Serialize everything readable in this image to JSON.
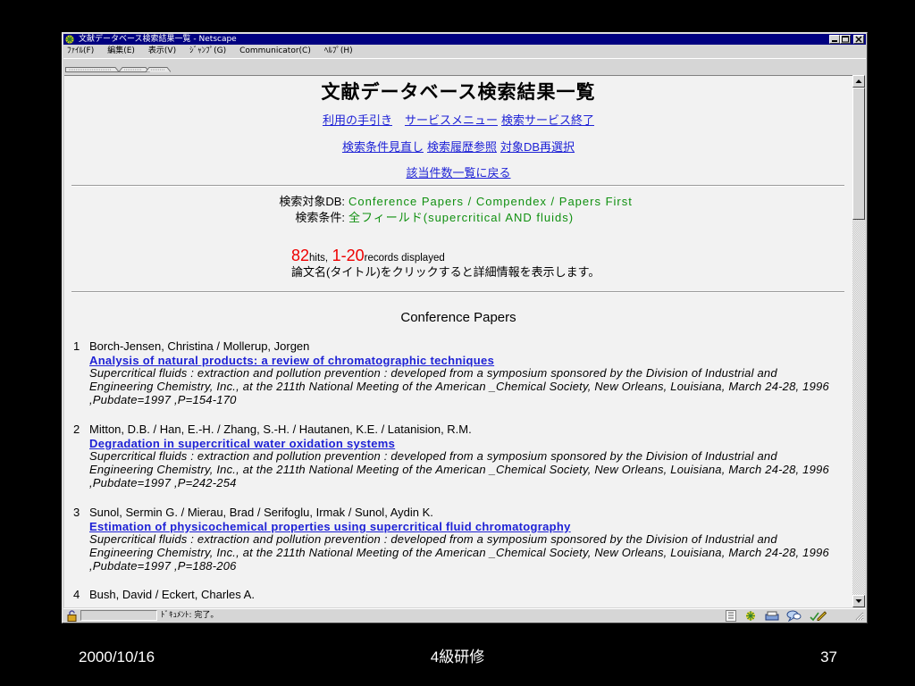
{
  "window": {
    "title": "文献データベース検索結果一覧 - Netscape",
    "menu": [
      "ﾌｧｲﾙ(F)",
      "編集(E)",
      "表示(V)",
      "ｼﾞｬﾝﾌﾟ(G)",
      "Communicator(C)",
      "ﾍﾙﾌﾟ(H)"
    ],
    "status_text": "ﾄﾞｷｭﾒﾝﾄ: 完了。",
    "icons": {
      "title": "netscape-icon",
      "window_buttons": [
        "minimize-icon",
        "maximize-icon",
        "close-icon"
      ],
      "scroll": [
        "arrow-up-icon",
        "arrow-down-icon"
      ],
      "status": [
        "security-lock-icon",
        "component-bar-handle-icon",
        "navigator-icon",
        "mailbox-icon",
        "discussion-icon",
        "composer-icon",
        "resize-grip-icon"
      ]
    }
  },
  "page": {
    "heading": "文献データベース検索結果一覧",
    "nav_row1": [
      "利用の手引き",
      "サービスメニュー",
      "検索サービス終了"
    ],
    "nav_row2": [
      "検索条件見直し",
      "検索履歴参照",
      "対象DB再選択"
    ],
    "nav_row3": [
      "該当件数一覧に戻る"
    ],
    "search_db_label": "検索対象DB:",
    "search_db_value": "Conference Papers / Compendex / Papers First",
    "search_cond_label": "検索条件:",
    "search_cond_value": "全フィールド(supercritical AND fluids)",
    "hits_count": "82",
    "hits_label": "hits,",
    "records_range": "1-20",
    "records_label": "records displayed",
    "instruction": "論文名(タイトル)をクリックすると詳細情報を表示します。",
    "section_title": "Conference Papers",
    "results": [
      {
        "number": "1",
        "authors": "Borch-Jensen, Christina / Mollerup, Jorgen",
        "title": "Analysis of natural products: a review of chromatographic techniques",
        "source_lines": [
          "Supercritical fluids : extraction and pollution prevention : developed from a symposium sponsored by the Division of Industrial and",
          "Engineering Chemistry, Inc., at the 211th National Meeting of the American _Chemical Society, New Orleans, Louisiana, March 24-28, 1996",
          ",Pubdate=1997 ,P=154-170"
        ]
      },
      {
        "number": "2",
        "authors": "Mitton, D.B. / Han, E.-H. / Zhang, S.-H. / Hautanen, K.E. / Latanision, R.M.",
        "title": "Degradation in supercritical water oxidation systems",
        "source_lines": [
          "Supercritical fluids : extraction and pollution prevention : developed from a symposium sponsored by the Division of Industrial and",
          "Engineering Chemistry, Inc., at the 211th National Meeting of the American _Chemical Society, New Orleans, Louisiana, March 24-28, 1996",
          ",Pubdate=1997 ,P=242-254"
        ]
      },
      {
        "number": "3",
        "authors": "Sunol, Sermin G. / Mierau, Brad / Serifoglu, Irmak / Sunol, Aydin K.",
        "title": "Estimation of physicochemical properties using supercritical fluid chromatography",
        "source_lines": [
          "Supercritical fluids : extraction and pollution prevention : developed from a symposium sponsored by the Division of Industrial and",
          "Engineering Chemistry, Inc., at the 211th National Meeting of the American _Chemical Society, New Orleans, Louisiana, March 24-28, 1996",
          ",Pubdate=1997 ,P=188-206"
        ]
      },
      {
        "number": "4",
        "authors": "Bush, David / Eckert, Charles A."
      }
    ]
  },
  "footer": {
    "date": "2000/10/16",
    "title": "4級研修",
    "page": "37"
  },
  "colors": {
    "slide_bg": "#000000",
    "footer_text": "#ffffff",
    "titlebar": "#000080",
    "chrome": "#d6d6d6",
    "content_bg": "#f2f2f2",
    "link": "#1e22d6",
    "value_green": "#109010",
    "count_red": "#ee0000"
  }
}
